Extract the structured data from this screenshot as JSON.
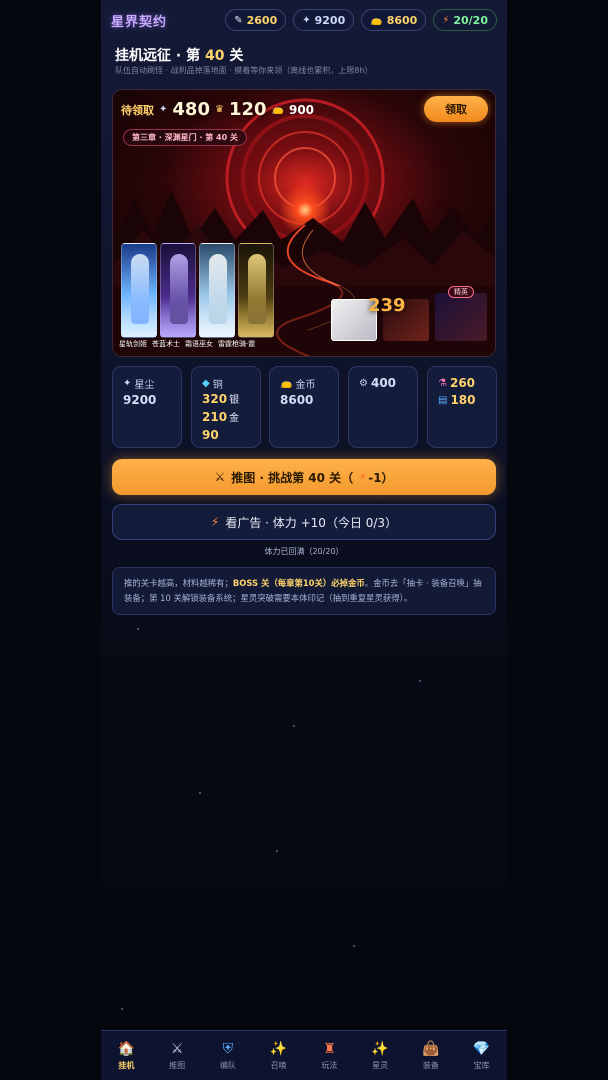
{
  "app": {
    "title": "星界契约"
  },
  "currencies": [
    {
      "icon": "feather-icon",
      "value": "2600",
      "color": "gold"
    },
    {
      "icon": "sparkle-icon",
      "value": "9200",
      "color": "blue"
    },
    {
      "icon": "money-bag-icon",
      "value": "8600",
      "color": "gold"
    },
    {
      "icon": "lightning-icon",
      "value": "20/20",
      "color": "green"
    }
  ],
  "header": {
    "title_prefix": "挂机远征 · 第",
    "level": "40",
    "title_suffix": "关",
    "subtitle": "队伍自动刷怪 · 战利品掉落地面 · 摸着等你来领（离线也累积，上限8h）"
  },
  "battle": {
    "pending_label": "待领取",
    "pending_stardust": "480",
    "pending_coin": "120",
    "pending_gold": "900",
    "claim_label": "领取",
    "chapter_tag": "第三章 · 深渊星门 · 第 40 关",
    "heroes": [
      "星轨剑姬",
      "苍蓝术士",
      "霜语巫女",
      "雷霆枪骑·霆"
    ],
    "damage": "239",
    "elite_tag": "精英"
  },
  "resources": {
    "stardust_label": "星尘",
    "stardust_value": "9200",
    "copper_label": "铜",
    "copper_value": "320",
    "silver_label": "银",
    "silver_value": "210",
    "gold_label": "金",
    "gold_value": "90",
    "coin_label": "金币",
    "coin_value": "8600",
    "gear_value": "400",
    "potion_value": "260",
    "book_value": "180"
  },
  "actions": {
    "push_label": "推图 · 挑战第 40 关（",
    "push_cost": "-1）",
    "ad_label": "看广告 · 体力 +10（今日 0/3）",
    "stamina_status": "体力已回满（20/20）"
  },
  "tip": {
    "part1": "推的关卡越高，材料越稀有；",
    "bold1": "BOSS 关（每章第10关）必掉金币",
    "part2": "。金币去「抽卡 · 装备召唤」抽装备；第 10 关解锁装备系统；星灵突破需要本体印记（抽到重复星灵获得）。"
  },
  "nav": [
    {
      "label": "挂机",
      "icon": "house-icon",
      "active": true
    },
    {
      "label": "推图",
      "icon": "crossed-swords-icon",
      "active": false
    },
    {
      "label": "编队",
      "icon": "shield-icon",
      "active": false
    },
    {
      "label": "召唤",
      "icon": "sparkles-icon",
      "active": false
    },
    {
      "label": "玩法",
      "icon": "tower-icon",
      "active": false
    },
    {
      "label": "星灵",
      "icon": "star-spark-icon",
      "active": false
    },
    {
      "label": "装备",
      "icon": "bag-icon",
      "active": false
    },
    {
      "label": "宝库",
      "icon": "gem-icon",
      "active": false
    }
  ],
  "colors": {
    "accent": "#ffb14a",
    "gold": "#ffd36b",
    "panel": "#141c3c",
    "battle_red": "#c4161e"
  }
}
